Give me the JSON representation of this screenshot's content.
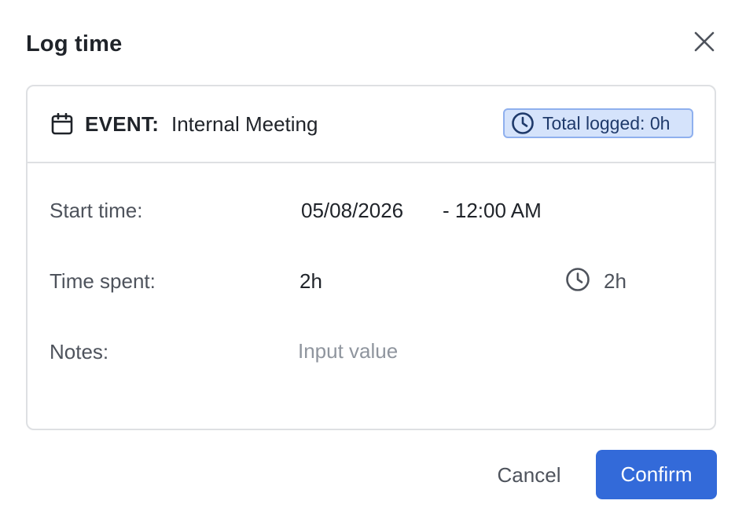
{
  "dialog": {
    "title": "Log time"
  },
  "event": {
    "label": "EVENT:",
    "name": "Internal Meeting",
    "icon": "calendar-icon",
    "total_logged": "Total logged: 0h",
    "total_icon": "clock-icon"
  },
  "form": {
    "start_time": {
      "label": "Start time:",
      "date": "05/08/2026",
      "time": "- 12:00 AM"
    },
    "time_spent": {
      "label": "Time spent:",
      "value": "2h",
      "clock_icon": "clock-icon",
      "clock_value": "2h"
    },
    "notes": {
      "label": "Notes:",
      "value": "",
      "placeholder": "Input value"
    }
  },
  "actions": {
    "cancel_label": "Cancel",
    "confirm_label": "Confirm"
  },
  "colors": {
    "accent": "#336ad9",
    "badge_bg": "#d5e3fb",
    "badge_border": "#8fb0ee",
    "border": "#dee0e3"
  }
}
